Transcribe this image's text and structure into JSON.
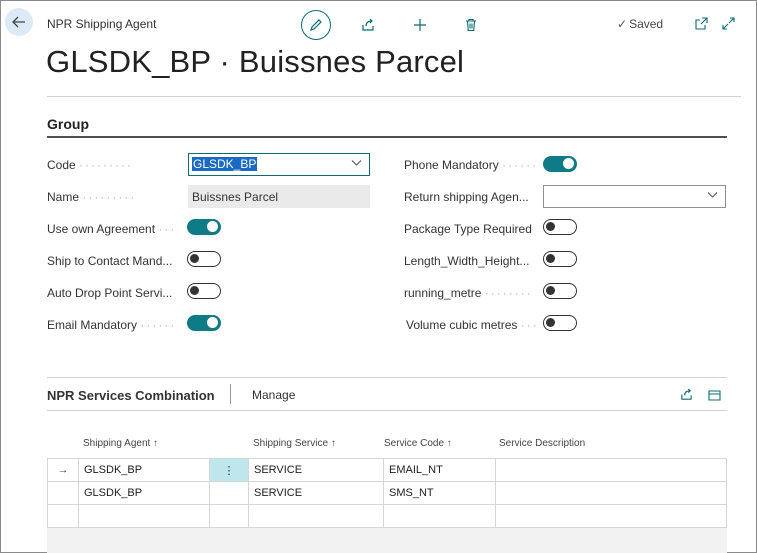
{
  "header": {
    "breadcrumb": "NPR Shipping Agent",
    "saved_label": "Saved",
    "title": "GLSDK_BP · Buissnes Parcel"
  },
  "group": {
    "title": "Group",
    "left_fields": [
      {
        "label": "Code",
        "type": "lookup",
        "value": "GLSDK_BP"
      },
      {
        "label": "Name",
        "type": "text",
        "value": "Buissnes Parcel"
      },
      {
        "label": "Use own Agreement",
        "type": "toggle",
        "on": true
      },
      {
        "label": "Ship to Contact Mand...",
        "type": "toggle",
        "on": false
      },
      {
        "label": "Auto Drop Point Servi...",
        "type": "toggle",
        "on": false
      },
      {
        "label": "Email Mandatory",
        "type": "toggle",
        "on": true
      }
    ],
    "right_fields": [
      {
        "label": "Phone Mandatory",
        "type": "toggle",
        "on": true
      },
      {
        "label": "Return shipping Agen...",
        "type": "lookup",
        "value": ""
      },
      {
        "label": "Package Type Required",
        "type": "toggle",
        "on": false
      },
      {
        "label": "Length_Width_Height...",
        "type": "toggle",
        "on": false
      },
      {
        "label": "running_metre",
        "type": "toggle",
        "on": false
      },
      {
        "label": "Volume cubic metres",
        "type": "toggle",
        "on": false
      }
    ]
  },
  "subpage": {
    "title": "NPR Services Combination",
    "manage_label": "Manage",
    "columns": [
      "Shipping Agent ↑",
      "Shipping Service ↑",
      "Service Code ↑",
      "Service Description"
    ],
    "rows": [
      {
        "shipping_agent": "GLSDK_BP",
        "shipping_service": "SERVICE",
        "service_code": "EMAIL_NT",
        "service_description": ""
      },
      {
        "shipping_agent": "GLSDK_BP",
        "shipping_service": "SERVICE",
        "service_code": "SMS_NT",
        "service_description": ""
      }
    ]
  },
  "colors": {
    "accent": "#0f7b86",
    "selection": "#1a6ac2"
  }
}
